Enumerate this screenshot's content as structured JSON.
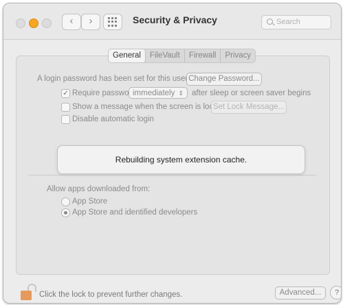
{
  "window": {
    "title": "Security & Privacy",
    "search_placeholder": "Search"
  },
  "tabs": [
    "General",
    "FileVault",
    "Firewall",
    "Privacy"
  ],
  "general": {
    "password_set_text": "A login password has been set for this user",
    "change_password_label": "Change Password...",
    "require_password_label": "Require password",
    "require_password_checked": true,
    "require_password_delay": "immediately",
    "after_sleep_text": "after sleep or screen saver begins",
    "show_message_label": "Show a message when the screen is locked",
    "show_message_checked": false,
    "set_lock_message_label": "Set Lock Message...",
    "disable_auto_login_label": "Disable automatic login",
    "disable_auto_login_checked": false,
    "allow_apps_label": "Allow apps downloaded from:",
    "options": [
      {
        "label": "App Store",
        "selected": false
      },
      {
        "label": "App Store and identified developers",
        "selected": true
      }
    ]
  },
  "overlay_message": "Rebuilding system extension cache.",
  "footer": {
    "lock_text": "Click the lock to prevent further changes.",
    "advanced_label": "Advanced...",
    "help_label": "?"
  },
  "icons": {
    "lock": "lock-open-icon",
    "search": "search-icon",
    "grid": "grid-icon",
    "back": "chevron-left-icon",
    "forward": "chevron-right-icon"
  },
  "colors": {
    "minimize_button": "#f5a623",
    "lock_body": "#e39a5c"
  }
}
